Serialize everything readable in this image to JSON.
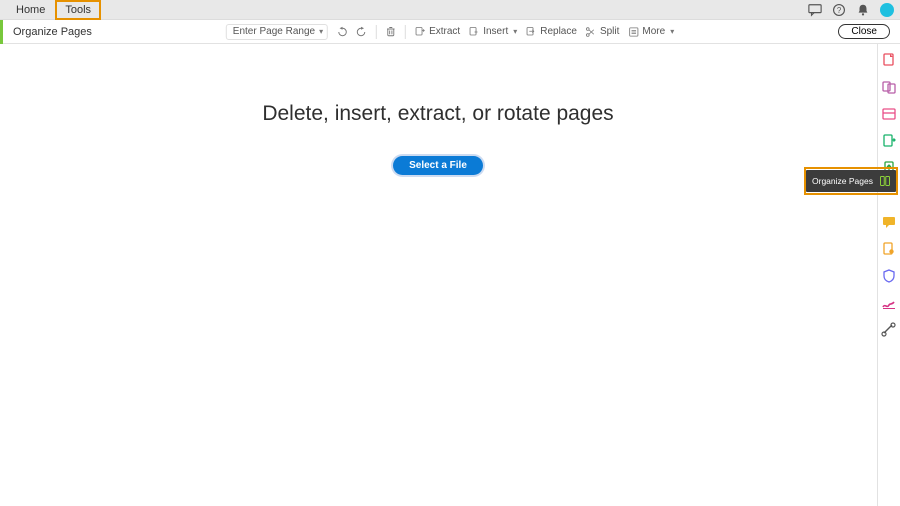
{
  "topbar": {
    "home_label": "Home",
    "tools_label": "Tools"
  },
  "top_right_icons": {
    "comment": "comments-icon",
    "help": "help-icon",
    "bell": "bell-icon",
    "avatar": "avatar"
  },
  "toolbar": {
    "title": "Organize Pages",
    "page_range_label": "Enter Page Range",
    "extract_label": "Extract",
    "insert_label": "Insert",
    "replace_label": "Replace",
    "split_label": "Split",
    "more_label": "More",
    "close_label": "Close"
  },
  "main": {
    "headline": "Delete, insert, extract, or rotate pages",
    "select_file_label": "Select a File"
  },
  "rail_items": [
    {
      "name": "create-pdf-icon",
      "color": "#e94f5f"
    },
    {
      "name": "combine-files-icon",
      "color": "#b85ea8"
    },
    {
      "name": "edit-pdf-icon",
      "color": "#e94f88"
    },
    {
      "name": "export-pdf-icon",
      "color": "#17b26a"
    },
    {
      "name": "share-icon",
      "color": "#2aa53f"
    },
    {
      "name": "comments-icon",
      "color": "#f0b429"
    },
    {
      "name": "stamp-icon",
      "color": "#f0a429"
    },
    {
      "name": "protect-icon",
      "color": "#6a6af0"
    },
    {
      "name": "sign-icon",
      "color": "#d63384"
    },
    {
      "name": "measure-icon",
      "color": "#555"
    }
  ],
  "flyout": {
    "label": "Organize Pages",
    "accent": "#8dd43a"
  },
  "colors": {
    "highlight_orange": "#e69100",
    "primary_blue": "#0b7bd6",
    "accent_green": "#78c83c"
  }
}
